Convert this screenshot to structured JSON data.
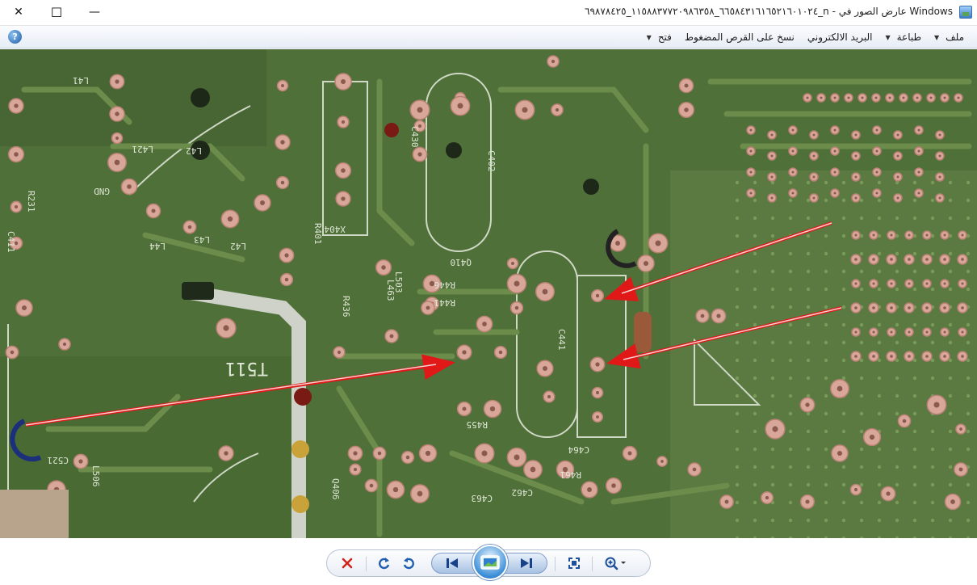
{
  "window": {
    "title": "Windows عارض الصور في - n_٦٦٥٨٤٣١٦١٦٥٢١٦٠١٠٢٤_١١٥٨٨٣٧٧٢٠٩٨٦٣٥٨_٦٩٨٧٨٤٢٥",
    "close_glyph": "✕",
    "maximize_glyph": "☐",
    "minimize_glyph": "—"
  },
  "menu": {
    "items": [
      {
        "label": "ملف",
        "has_dropdown": true
      },
      {
        "label": "طباعة",
        "has_dropdown": true
      },
      {
        "label": "البريد الالكتروني",
        "has_dropdown": false
      },
      {
        "label": "نسخ على القرص المضغوط",
        "has_dropdown": false
      },
      {
        "label": "فتح",
        "has_dropdown": true
      }
    ],
    "help_glyph": "?"
  },
  "photo": {
    "board_labels": [
      "T511",
      "C521",
      "L506",
      "L503",
      "R461",
      "C441",
      "R441",
      "Q406",
      "C462",
      "R455",
      "C463",
      "L463",
      "C464",
      "R446",
      "R436",
      "X404",
      "R401",
      "C430",
      "C402",
      "Q410",
      "R231",
      "L41",
      "L42",
      "L43",
      "L44",
      "GND",
      "L42",
      "C411",
      "L421"
    ],
    "colors": {
      "board": "#4f7038",
      "board_dark": "#3f5c2c",
      "trace": "#6b8c4a",
      "pad": "#d9a79a",
      "silk": "#cfd8c5",
      "arrow": "#e01818"
    }
  },
  "toolbar": {
    "delete_icon": "delete-icon",
    "rotate_cw_icon": "rotate-clockwise-icon",
    "rotate_ccw_icon": "rotate-counterclockwise-icon",
    "prev_icon": "previous-icon",
    "slideshow_icon": "slideshow-icon",
    "next_icon": "next-icon",
    "actual_size_icon": "actual-size-icon",
    "zoom_icon": "zoom-icon"
  }
}
